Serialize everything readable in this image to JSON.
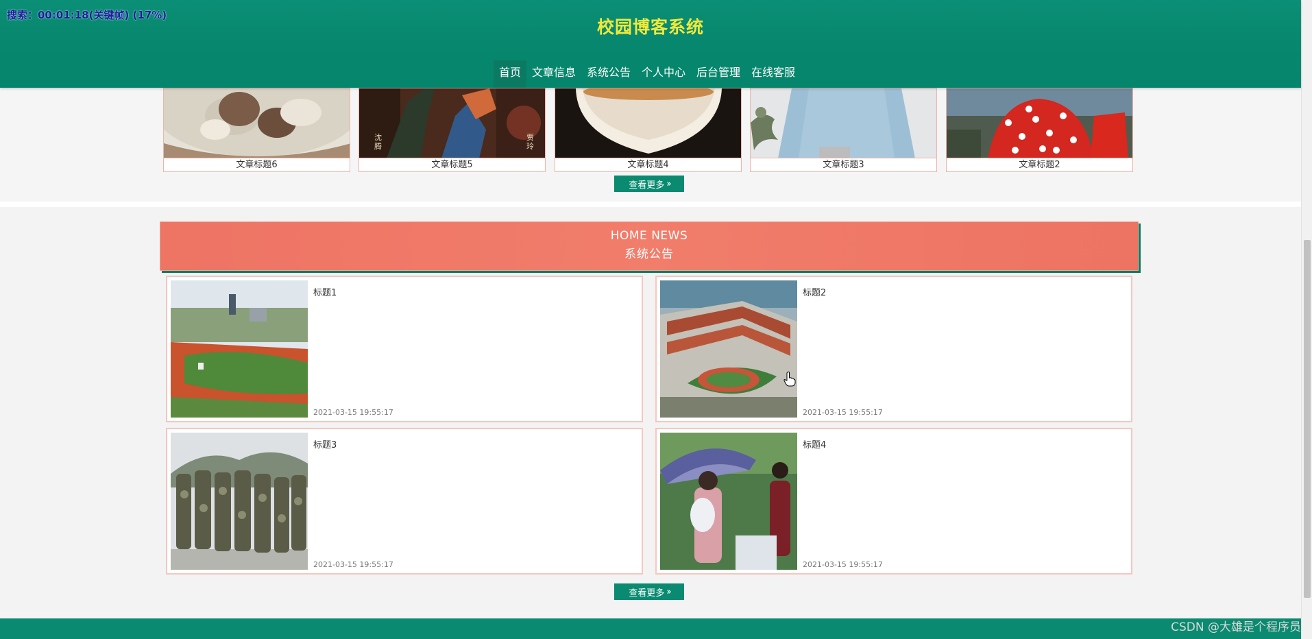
{
  "overlay": {
    "text": "搜索：00:01:18(关键帧) (17%)"
  },
  "header": {
    "site_title": "校园博客系统",
    "nav": [
      {
        "label": "首页",
        "active": true
      },
      {
        "label": "文章信息",
        "active": false
      },
      {
        "label": "系统公告",
        "active": false
      },
      {
        "label": "个人中心",
        "active": false
      },
      {
        "label": "后台管理",
        "active": false
      },
      {
        "label": "在线客服",
        "active": false
      }
    ]
  },
  "articles": {
    "items": [
      {
        "title": "文章标题6",
        "image": "food-bowl-image"
      },
      {
        "title": "文章标题5",
        "image": "movie-poster-image"
      },
      {
        "title": "文章标题4",
        "image": "coffee-cup-image"
      },
      {
        "title": "文章标题3",
        "image": "sweater-image"
      },
      {
        "title": "文章标题2",
        "image": "minnie-mouse-image"
      }
    ],
    "more_label": "查看更多"
  },
  "news": {
    "banner_en": "HOME NEWS",
    "banner_cn": "系统公告",
    "items": [
      {
        "title": "标题1",
        "date": "2021-03-15 19:55:17",
        "image": "sports-field-image"
      },
      {
        "title": "标题2",
        "date": "2021-03-15 19:55:17",
        "image": "campus-building-image"
      },
      {
        "title": "标题3",
        "date": "2021-03-15 19:55:17",
        "image": "military-training-image"
      },
      {
        "title": "标题4",
        "date": "2021-03-15 19:55:17",
        "image": "umbrella-students-image"
      }
    ],
    "more_label": "查看更多"
  },
  "watermark": "CSDN @大雄是个程序员",
  "colors": {
    "primary": "#0a8a70",
    "banner": "#ef7866",
    "title": "#f1e93a"
  }
}
